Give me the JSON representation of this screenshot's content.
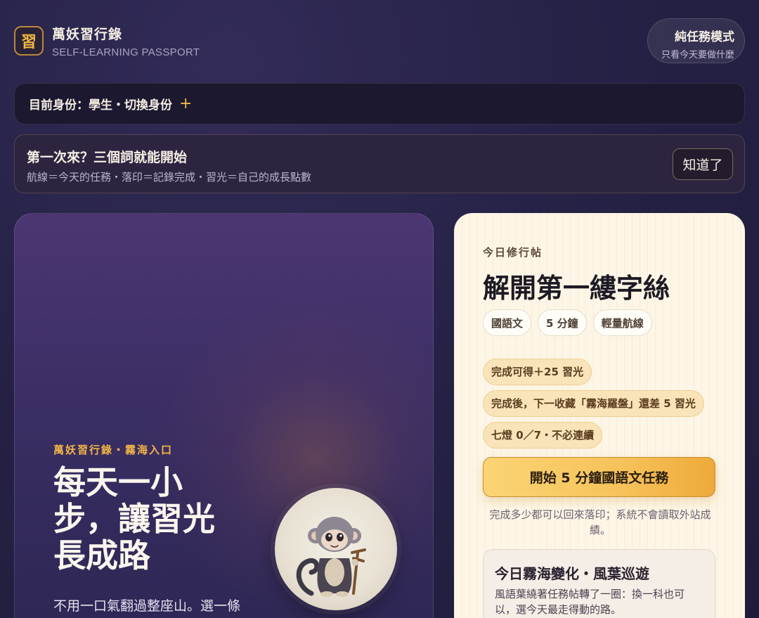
{
  "header": {
    "logo_glyph": "習",
    "app_title": "萬妖習行錄",
    "app_subtitle": "SELF-LEARNING PASSPORT",
    "mode_button": {
      "title": "純任務模式",
      "subtitle": "只看今天要做什麼"
    }
  },
  "identity": {
    "label": "目前身份：學生・切換身份",
    "add_icon": "plus-icon"
  },
  "intro": {
    "heading": "第一次來？三個詞就能開始",
    "text": "航線＝今天的任務・落印＝記錄完成・習光＝自己的成長點數",
    "dismiss_label": "知道了"
  },
  "hero": {
    "kicker": "萬妖習行錄・霧海入口",
    "headline": "每天一小步，讓習光長成路",
    "description": "不用一口氣翻過整座山。選一條",
    "mascot_icon": "monkey-mascot-icon"
  },
  "task": {
    "kicker": "今日修行帖",
    "title": "解開第一縷字絲",
    "chips": [
      "國語文",
      "5 分鐘",
      "輕量航線"
    ],
    "rewards": [
      "完成可得＋25 習光",
      "完成後，下一收藏「霧海羅盤」還差 5 習光",
      "七燈 0／7・不必連續"
    ],
    "start_label": "開始 5 分鐘國語文任務",
    "note": "完成多少都可以回來落印；系統不會讀取外站成績。",
    "event": {
      "title": "今日霧海變化・風葉巡遊",
      "text": "風語葉繞著任務帖轉了一圈：換一科也可以，選今天最走得動的路。"
    }
  },
  "colors": {
    "accent_gold": "#f2b543",
    "background": "#262247",
    "card_cream": "#fdf6e6"
  }
}
